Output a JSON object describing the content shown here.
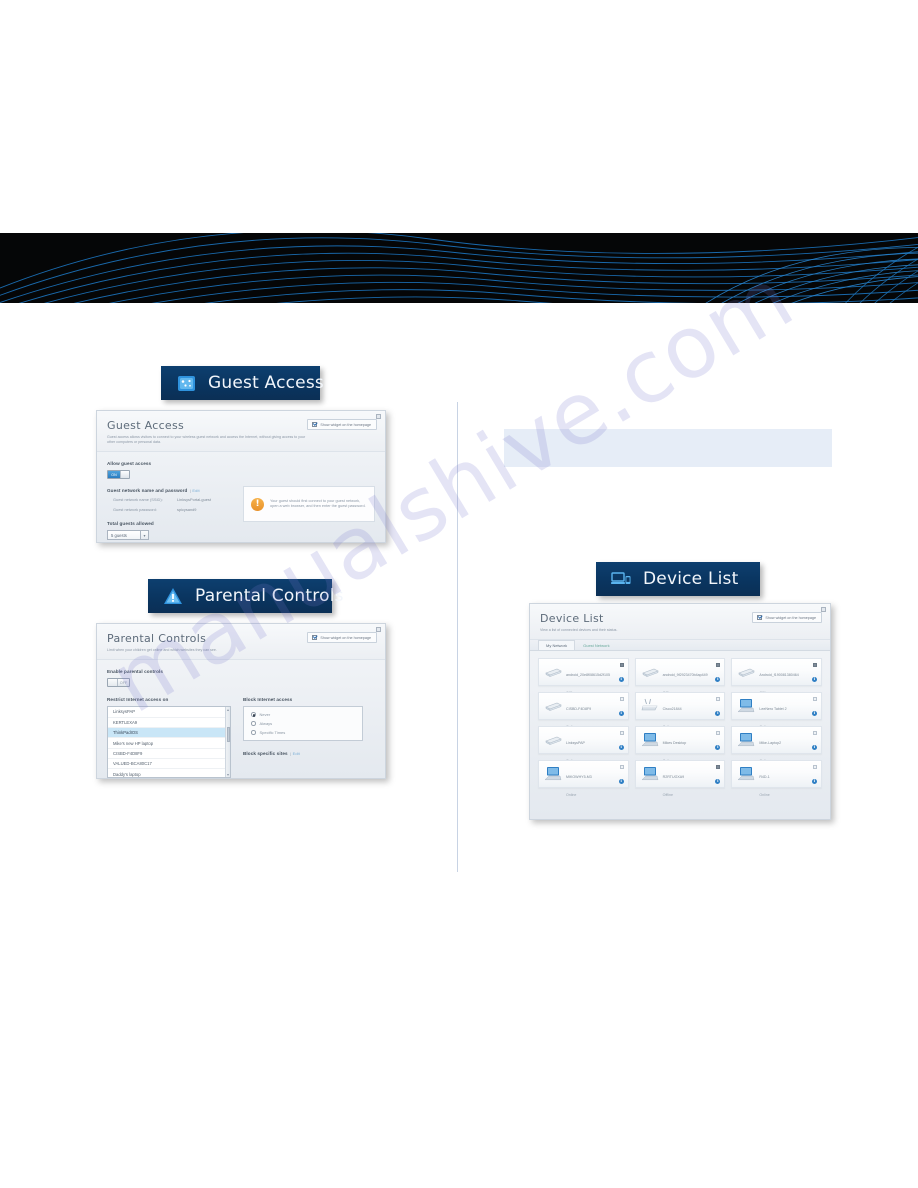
{
  "page": {
    "watermark": "manualshive.com"
  },
  "sections": {
    "guest_access": {
      "banner_label": "Guest Access",
      "banner_icon": "guest-access-icon",
      "window": {
        "title": "Guest Access",
        "subtitle": "Guest access allows visitors to connect to your wireless guest network and access the Internet, without giving access to your other computers or personal data.",
        "widget_checkbox_label": "Show widget on the homepage",
        "allow_label": "Allow guest access",
        "toggle_state": "ON",
        "toggle_on_text": "ON",
        "credentials_label": "Guest network name and password",
        "credentials_hint": "Edit",
        "ssid_key": "Guest network name (SSID):",
        "ssid_value": "LinksysPortal-guest",
        "password_key": "Guest network password:",
        "password_value": "spicysand9",
        "total_label": "Total guests allowed",
        "total_value": "5 guests",
        "alert_text": "Your guest should first connect to your guest network, open a web browser, and then enter the guest password."
      }
    },
    "parental_controls": {
      "banner_label": "Parental Controls",
      "banner_icon": "warning-triangle-icon",
      "window": {
        "title": "Parental Controls",
        "subtitle": "Limit when your children get online and which websites they can see.",
        "widget_checkbox_label": "Show widget on the homepage",
        "enable_label": "Enable parental controls",
        "toggle_state": "OFF",
        "toggle_off_text": "OFF",
        "restrict_label": "Restrict Internet access on",
        "devices": [
          {
            "name": "LinksysPAP",
            "selected": false
          },
          {
            "name": "KERTLEXA9",
            "selected": false
          },
          {
            "name": "ThinkPadIOS",
            "selected": true
          },
          {
            "name": "Mike's new HP laptop",
            "selected": false
          },
          {
            "name": "CISBD-F4D8F9",
            "selected": false
          },
          {
            "name": "VALUED-BCA80C17",
            "selected": false
          },
          {
            "name": "Daddy's laptop",
            "selected": false
          }
        ],
        "block_label": "Block Internet access",
        "block_options": [
          {
            "label": "Never",
            "selected": true
          },
          {
            "label": "Always",
            "selected": false
          },
          {
            "label": "Specific Times",
            "selected": false
          }
        ],
        "block_sites_label": "Block specific sites",
        "block_sites_hint": "Edit"
      }
    },
    "device_list": {
      "banner_label": "Device List",
      "banner_icon": "laptop-phone-icon",
      "window": {
        "title": "Device List",
        "subtitle": "View a list of connected devices and their status.",
        "widget_checkbox_label": "Show widget on the homepage",
        "tabs": [
          {
            "label": "My Network",
            "active": true
          },
          {
            "label": "Guest Network",
            "active": false
          }
        ],
        "devices": [
          {
            "name": "android_20e8f08615d2f105",
            "status": "Offline",
            "icon": "router-icon",
            "flag": true
          },
          {
            "name": "android_9f2923470b4ap449",
            "status": "Offline",
            "icon": "router-icon",
            "flag": true
          },
          {
            "name": "Android_f190081380464",
            "status": "Offline",
            "icon": "router-icon",
            "flag": true
          },
          {
            "name": "CISBD-F4D8F9",
            "status": "Online",
            "icon": "router-icon",
            "flag": false
          },
          {
            "name": "Cisco21844",
            "status": "Online",
            "icon": "access-point-icon",
            "flag": false
          },
          {
            "name": "LeeNero Tablet 2",
            "status": "Online",
            "icon": "desktop-icon",
            "flag": false
          },
          {
            "name": "LinksysPAP",
            "status": "Online",
            "icon": "router-icon",
            "flag": false
          },
          {
            "name": "Mikes Desktop",
            "status": "Online",
            "icon": "desktop-icon",
            "flag": false
          },
          {
            "name": "Mike-Laptop2",
            "status": "Online",
            "icon": "desktop-icon",
            "flag": false
          },
          {
            "name": "MIKOWHY5-M3",
            "status": "Online",
            "icon": "desktop-icon",
            "flag": false
          },
          {
            "name": "R2RTUGXA9",
            "status": "Offline",
            "icon": "desktop-icon",
            "flag": true
          },
          {
            "name": "R4D-1",
            "status": "Online",
            "icon": "desktop-icon",
            "flag": false
          }
        ],
        "info_badge": "i"
      }
    }
  },
  "colors": {
    "banner_blue": "#0b3560",
    "accent_blue": "#2d7ec4",
    "alert_orange": "#e8912a",
    "selected_row": "#c9e6f7"
  }
}
